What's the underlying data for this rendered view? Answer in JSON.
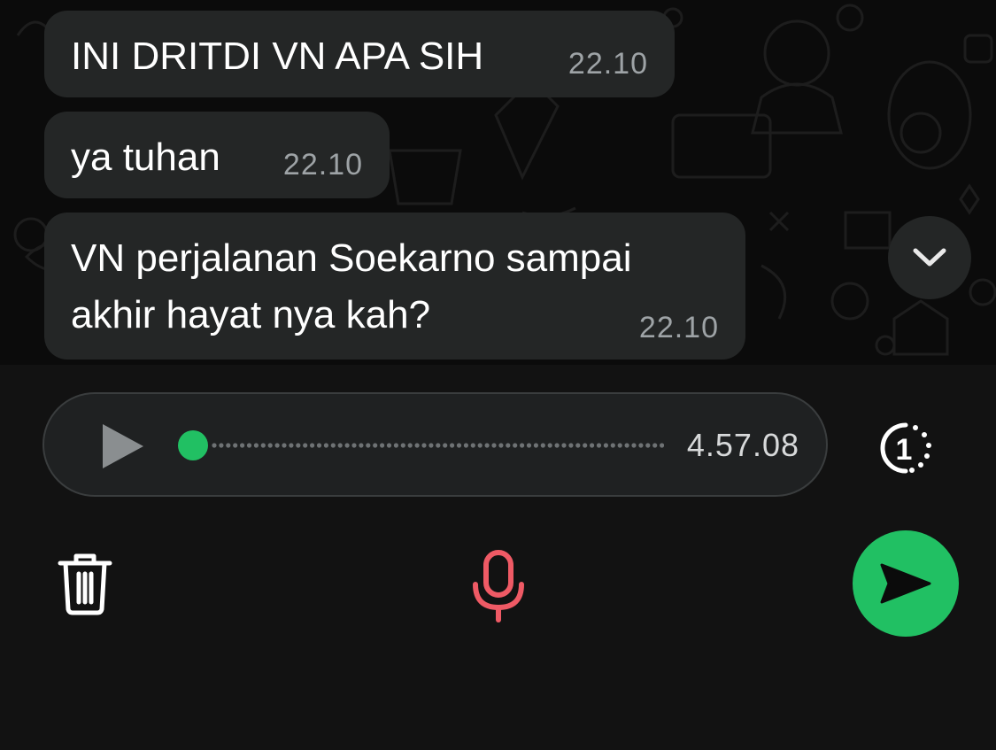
{
  "messages": [
    {
      "text": "INI DRITDI VN APA SIH",
      "time": "22.10"
    },
    {
      "text": "ya tuhan",
      "time": "22.10"
    },
    {
      "text": "VN perjalanan Soekarno sampai\nakhir hayat nya kah?",
      "time": "22.10"
    }
  ],
  "recorder": {
    "duration": "4.57.08",
    "progress": 0,
    "view_once_label": "1"
  },
  "icons": {
    "scroll": "chevron-down-icon",
    "play": "play-icon",
    "view_once": "view-once-icon",
    "delete": "trash-icon",
    "mic": "microphone-icon",
    "send": "send-icon"
  },
  "colors": {
    "accent": "#21c063",
    "mic": "#ef5a65",
    "bubble": "#242626",
    "timestamp": "#9ea3a6"
  }
}
